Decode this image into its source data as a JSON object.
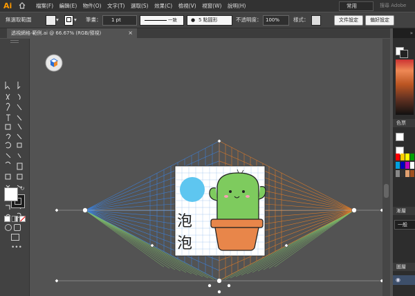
{
  "app": {
    "logo": "Ai",
    "workspace": "常用",
    "search": "搜尋 Adobe"
  },
  "menu": [
    "檔案(F)",
    "編輯(E)",
    "物件(O)",
    "文字(T)",
    "選取(S)",
    "效果(C)",
    "檢視(V)",
    "視窗(W)",
    "說明(H)"
  ],
  "control_bar": {
    "selection_label": "無選取範圍",
    "stroke_label": "筆畫：",
    "stroke_weight": "1 pt",
    "stroke_style": "一致",
    "brush": "5 點圓形",
    "opacity_label": "不透明度：",
    "opacity_value": "100%",
    "style_label": "樣式：",
    "doc_setup": "文件設定",
    "preferences": "偏好設定"
  },
  "tab": {
    "title": "透視網格-範例.ai @ 66.67% (RGB/預視)",
    "close": "×"
  },
  "artwork": {
    "line1": "泡",
    "line2": "泡"
  },
  "panels": {
    "color": "色票",
    "gradient": "漸層",
    "blend_mode": "一般",
    "layers": "圖層"
  },
  "colors": {
    "accent": "#ff9a00",
    "canvas": "#535353",
    "left_grid": "#3d7fd6",
    "right_grid": "#d97a2a",
    "ground_grid": "#7fc06a",
    "cactus": "#7ecb5e",
    "pot": "#e8864a",
    "sun": "#5ec6f0"
  }
}
